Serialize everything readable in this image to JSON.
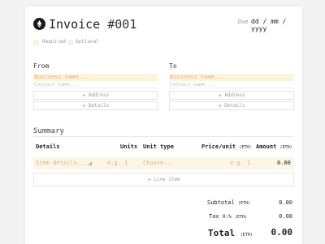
{
  "header": {
    "title": "Invoice ",
    "number": "#001",
    "due_label": "Due",
    "due_placeholder": "dd / mm / yyyy"
  },
  "legend": {
    "required": "Required",
    "optional": "Optional",
    "required_color": "#fdf3dc",
    "optional_color": "#eef1f6"
  },
  "from": {
    "label": "From",
    "business_placeholder": "Business name...",
    "contact_placeholder": "Contact name...",
    "address_button": "Address",
    "details_button": "Details"
  },
  "to": {
    "label": "To",
    "business_placeholder": "Business name...",
    "contact_placeholder": "Contact name...",
    "address_button": "Address",
    "details_button": "Details"
  },
  "summary": {
    "title": "Summary",
    "columns": {
      "details": "Details",
      "units": "Units",
      "unit_type": "Unit type",
      "price_unit": "Price/unit",
      "price_unit_currency": "(ETH)",
      "amount": "Amount",
      "amount_currency": "(ETH)"
    },
    "row": {
      "details_placeholder": "Item details...",
      "units_placeholder": "e.g. 1",
      "unit_type_placeholder": "Choose...",
      "price_placeholder": "e.g. 1",
      "amount": "0.00"
    },
    "line_item_button": "Line item"
  },
  "totals": {
    "subtotal_label": "Subtotal",
    "subtotal_currency": "(ETH)",
    "subtotal_value": "0.00",
    "tax_label": "Tax",
    "tax_rate": "0:%",
    "tax_currency": "(ETH)",
    "tax_value": "0.00",
    "total_label": "Total",
    "total_currency": "(ETH)",
    "total_value": "0.00"
  }
}
